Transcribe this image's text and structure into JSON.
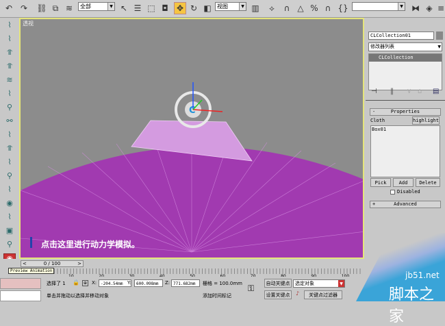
{
  "toolbar": {
    "selection_filter": "全部",
    "ref_coord": "视图",
    "named_selection": ""
  },
  "viewport": {
    "label": "透视",
    "hint": "点击这里进行动力学模拟。",
    "colors": {
      "background": "#8c8c8c",
      "ground": "#a13ab0",
      "cloth": "#d49be0",
      "border": "#e5e57a"
    }
  },
  "command_panel": {
    "object_name": "CLCollection01",
    "modifier_list": "修改器列表",
    "stack_item": "CLCollection",
    "properties": {
      "title": "Properties",
      "collapse": "-",
      "cloth_label": "Cloth",
      "highlight_button": "highlight",
      "list_items": [
        "Box01"
      ],
      "pick": "Pick",
      "add": "Add",
      "delete": "Delete",
      "disabled": "Disabled"
    },
    "advanced": {
      "title": "Advanced",
      "expand": "+"
    }
  },
  "timeline": {
    "slider": "0 / 100",
    "tooltip": "Preview Animation",
    "ticks": [
      "10",
      "20",
      "30",
      "40",
      "50",
      "60",
      "70",
      "80",
      "90",
      "100"
    ]
  },
  "status": {
    "selected": "选择了 1",
    "x_label": "X:",
    "x": "-204.54mm",
    "y_label": "Y:",
    "y": "600.098mm",
    "z_label": "Z:",
    "z": "771.682mm",
    "grid": "栅格 = 100.0mm",
    "prompt": "单击并拖动以选择并移动对象",
    "add_time_tag": "添加时间标记",
    "auto_key": "自动关键点",
    "set_key": "设置关键点",
    "key_mode": "选定对象",
    "key_filters": "关键点过滤器"
  },
  "watermark": {
    "site": "jb51.net",
    "name": "脚本之家"
  }
}
